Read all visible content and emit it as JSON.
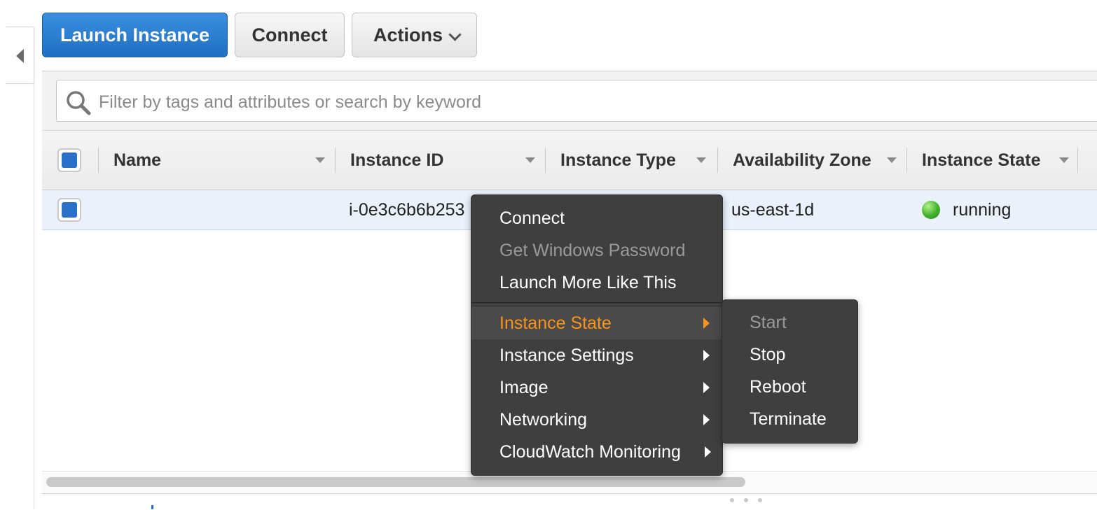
{
  "toolbar": {
    "launch_label": "Launch Instance",
    "connect_label": "Connect",
    "actions_label": "Actions"
  },
  "search": {
    "placeholder": "Filter by tags and attributes or search by keyword",
    "value": ""
  },
  "table": {
    "columns": [
      "Name",
      "Instance ID",
      "Instance Type",
      "Availability Zone",
      "Instance State"
    ],
    "rows": [
      {
        "name": "",
        "instance_id": "i-0e3c6b6b253",
        "instance_type": "",
        "availability_zone": "us-east-1d",
        "instance_state": "running",
        "state_color": "#3fb12c"
      }
    ]
  },
  "context_menu": {
    "items": [
      {
        "label": "Connect",
        "disabled": false
      },
      {
        "label": "Get Windows Password",
        "disabled": true
      },
      {
        "label": "Launch More Like This",
        "disabled": false
      },
      {
        "label": "Instance State",
        "submenu": true,
        "active": true
      },
      {
        "label": "Instance Settings",
        "submenu": true
      },
      {
        "label": "Image",
        "submenu": true
      },
      {
        "label": "Networking",
        "submenu": true
      },
      {
        "label": "CloudWatch Monitoring",
        "submenu": true
      }
    ]
  },
  "submenu": {
    "items": [
      {
        "label": "Start",
        "disabled": true
      },
      {
        "label": "Stop",
        "disabled": false
      },
      {
        "label": "Reboot",
        "disabled": false
      },
      {
        "label": "Terminate",
        "disabled": false
      }
    ]
  },
  "colors": {
    "primary_button": "#1f6fc4",
    "menu_background": "#3f3f3f",
    "menu_active_text": "#f7941e",
    "selected_row": "#eaf1fb"
  }
}
